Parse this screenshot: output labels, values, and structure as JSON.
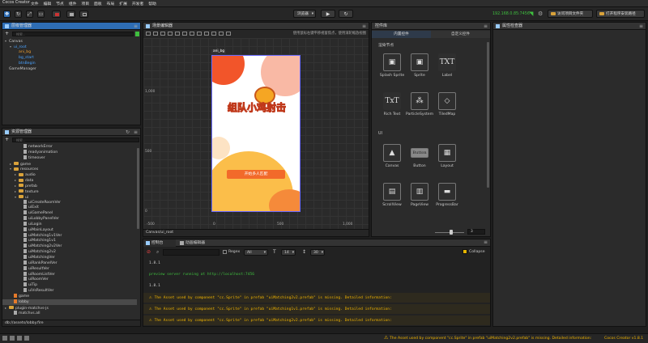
{
  "window": {
    "title": "Cocos Creator"
  },
  "menubar": [
    "文件",
    "编辑",
    "节点",
    "组件",
    "项目",
    "面板",
    "布局",
    "扩展",
    "开发者",
    "帮助"
  ],
  "toolbar": {
    "platform": "浏览器",
    "ip": "192.168.0.85:7456",
    "open_app": "访问项目文件夹",
    "open_program": "打开程序安装路径"
  },
  "hierarchy": {
    "title": "层级管理器",
    "search_placeholder": "搜索...",
    "nodes": [
      {
        "label": "Canvas",
        "depth": 0,
        "expanded": true
      },
      {
        "label": "ui_root",
        "depth": 1,
        "expanded": true,
        "color": "#4aa3ff"
      },
      {
        "label": "ani_bg",
        "depth": 2,
        "color": "#f0a030"
      },
      {
        "label": "bg_start",
        "depth": 2,
        "color": "#4aa3ff"
      },
      {
        "label": "btnBegin",
        "depth": 2,
        "color": "#4aa3ff"
      },
      {
        "label": "GameManager",
        "depth": 0
      }
    ]
  },
  "assets": {
    "title": "资源管理器",
    "search_placeholder": "搜索...",
    "items": [
      {
        "label": "networkError",
        "depth": 3,
        "type": "file"
      },
      {
        "label": "readyanimation",
        "depth": 3,
        "type": "file"
      },
      {
        "label": "timeover",
        "depth": 3,
        "type": "file"
      },
      {
        "label": "game",
        "depth": 1,
        "type": "folder"
      },
      {
        "label": "resources",
        "depth": 1,
        "type": "folder",
        "expanded": true
      },
      {
        "label": "audio",
        "depth": 2,
        "type": "folder"
      },
      {
        "label": "data",
        "depth": 2,
        "type": "folder"
      },
      {
        "label": "prefab",
        "depth": 2,
        "type": "folder"
      },
      {
        "label": "texture",
        "depth": 2,
        "type": "folder"
      },
      {
        "label": "ui",
        "depth": 2,
        "type": "folder",
        "expanded": true
      },
      {
        "label": "uiCreateRoomVer",
        "depth": 3,
        "type": "file"
      },
      {
        "label": "uiExit",
        "depth": 3,
        "type": "file"
      },
      {
        "label": "uiGamePanel",
        "depth": 3,
        "type": "file"
      },
      {
        "label": "uiLobbyPanelVer",
        "depth": 3,
        "type": "file"
      },
      {
        "label": "uiLogin",
        "depth": 3,
        "type": "file"
      },
      {
        "label": "uiMainLayout",
        "depth": 3,
        "type": "file"
      },
      {
        "label": "uiMatching1v1Ver",
        "depth": 3,
        "type": "file"
      },
      {
        "label": "uiMatching1v1",
        "depth": 3,
        "type": "file"
      },
      {
        "label": "uiMatching2v2Ver",
        "depth": 3,
        "type": "file"
      },
      {
        "label": "uiMatching2v2",
        "depth": 3,
        "type": "file"
      },
      {
        "label": "uiMatchingVer",
        "depth": 3,
        "type": "file"
      },
      {
        "label": "uiRankPanelVer",
        "depth": 3,
        "type": "file"
      },
      {
        "label": "uiResultVer",
        "depth": 3,
        "type": "file"
      },
      {
        "label": "uiRoomListVer",
        "depth": 3,
        "type": "file"
      },
      {
        "label": "uiRoomVer",
        "depth": 3,
        "type": "file"
      },
      {
        "label": "uiTip",
        "depth": 3,
        "type": "file"
      },
      {
        "label": "uiVsResultVer",
        "depth": 3,
        "type": "file"
      },
      {
        "label": "game",
        "depth": 1,
        "type": "scene"
      },
      {
        "label": "lobby",
        "depth": 1,
        "type": "scene",
        "selected": true
      },
      {
        "label": "plugin-matchvs-js",
        "depth": 0,
        "type": "folder"
      },
      {
        "label": "matchvs.all",
        "depth": 1,
        "type": "file"
      }
    ],
    "path": "db://assets/lobby.fire"
  },
  "scene": {
    "title": "场景编辑器",
    "hint": "使用鼠标右键平移视窗焦点，使用滚轮缩放视图",
    "canvas_label": "ani_bg",
    "ruler_left": [
      "1,000",
      "500",
      "0"
    ],
    "ruler_bottom": [
      "-500",
      "0",
      "500",
      "1,000"
    ],
    "footer": "Canvas/ui_root",
    "game_title": "组队小鸡射击",
    "start_button": "开始多人匹配"
  },
  "library": {
    "title": "控件库",
    "tabs": [
      "内置控件",
      "自定义控件"
    ],
    "section_render": "渲染节点",
    "section_ui": "UI",
    "render_items": [
      {
        "label": "Splash Sprite",
        "glyph": "▣"
      },
      {
        "label": "Sprite",
        "glyph": "▣"
      },
      {
        "label": "Label",
        "glyph": "TXT"
      },
      {
        "label": "Rich Text",
        "glyph": "TxT"
      },
      {
        "label": "ParticleSystem",
        "glyph": "⁂"
      },
      {
        "label": "TiledMap",
        "glyph": "◇"
      }
    ],
    "ui_items": [
      {
        "label": "Canvas",
        "glyph": "▲"
      },
      {
        "label": "Button",
        "glyph": "Button"
      },
      {
        "label": "Layout",
        "glyph": "▦"
      },
      {
        "label": "ScrollView",
        "glyph": "▤"
      },
      {
        "label": "PageView",
        "glyph": "▥"
      },
      {
        "label": "ProgressBar",
        "glyph": "▬"
      }
    ],
    "zoom_value": "3"
  },
  "inspector": {
    "title": "属性检查器"
  },
  "console": {
    "tabs": [
      "控制台",
      "动画编辑器"
    ],
    "filter_label": "Regex",
    "level": "All",
    "font_size": "14",
    "line_height": "30",
    "collapse_label": "Collapse",
    "logs": [
      {
        "text": "1.8.1",
        "type": "info"
      },
      {
        "text": "preview server running at http://localhost:7456",
        "type": "success"
      },
      {
        "text": "1.8.1",
        "type": "info"
      },
      {
        "text": "The Asset used by component \"cc.Sprite\" in prefab \"uiMatching2v2.prefab\" is missing. Detailed information:",
        "type": "warn"
      },
      {
        "text": "The Asset used by component \"cc.Sprite\" in prefab \"uiMatching1v1.prefab\" is missing. Detailed information:",
        "type": "warn"
      },
      {
        "text": "The Asset used by component \"cc.Sprite\" in prefab \"uiMatching2v2.prefab\" is missing. Detailed information:",
        "type": "warn"
      }
    ]
  },
  "statusbar": {
    "message": "The Asset used by component \"cc.Sprite\" in prefab \"uiMatching2v2.prefab\" is missing. Detailed information:",
    "version": "Cocos Creator v1.8.1"
  },
  "colors": {
    "accent": "#2e6db4",
    "warn": "#f0b400",
    "orange_button": "#f26a2a"
  }
}
